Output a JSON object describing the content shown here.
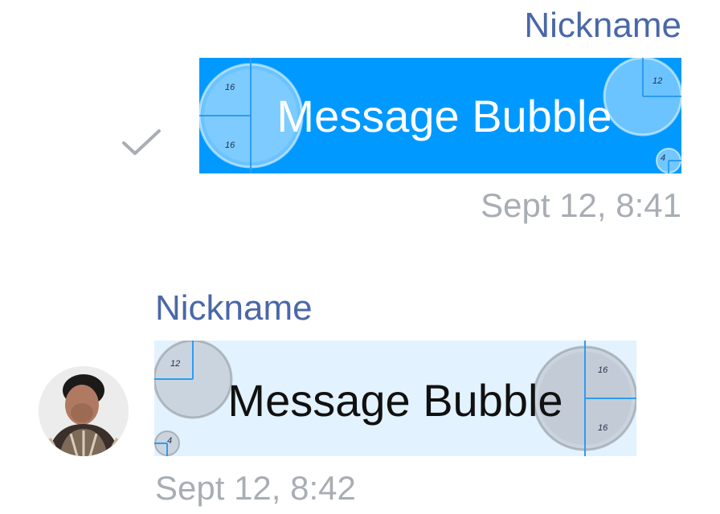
{
  "messages": [
    {
      "direction": "outgoing",
      "nickname": "Nickname",
      "text": "Message Bubble",
      "time": "Sept 12, 8:41",
      "status_icon": "checkmark-icon",
      "bubble_color": "#0099ff",
      "text_color": "#ffffff",
      "radius_specs": [
        "16",
        "16",
        "12",
        "4"
      ]
    },
    {
      "direction": "incoming",
      "nickname": "Nickname",
      "text": "Message Bubble",
      "time": "Sept 12, 8:42",
      "avatar_icon": "user-avatar",
      "bubble_color": "#e3f2ff",
      "text_color": "#111111",
      "radius_specs": [
        "12",
        "4",
        "16",
        "16"
      ]
    }
  ],
  "colors": {
    "nickname": "#4a68a8",
    "timestamp": "#a9adb4",
    "guide_line": "#2d9cf0",
    "checkmark": "#a9adb4"
  }
}
